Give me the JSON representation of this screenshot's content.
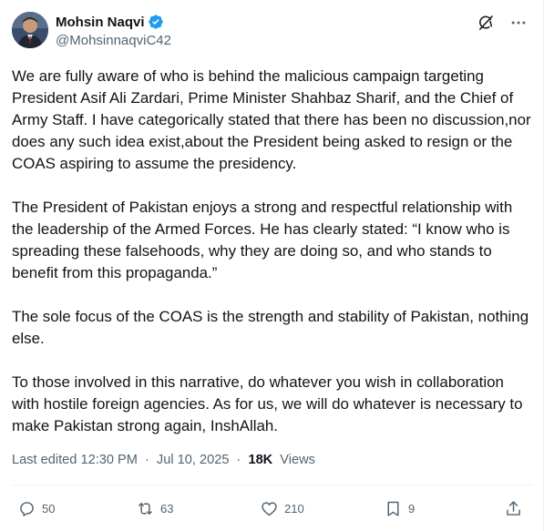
{
  "author": {
    "display_name": "Mohsin Naqvi",
    "handle": "@MohsinnaqviC42",
    "verified": true,
    "verified_color": "#1d9bf0"
  },
  "header_icons": {
    "grok": "grok-slash-icon",
    "more": "more-dots-icon"
  },
  "post": {
    "paragraphs": [
      "We are fully aware of who is behind the malicious campaign targeting President Asif Ali Zardari, Prime Minister Shahbaz Sharif, and the Chief of Army Staff. I have categorically stated that there has been no discussion,nor does any such idea exist,about the President being asked to resign or the COAS aspiring to assume the presidency.",
      "The President of Pakistan enjoys a strong and respectful relationship with the leadership of the Armed Forces. He has clearly stated: “I know who is spreading these falsehoods, why they are doing so, and who stands to benefit from this propaganda.”",
      "The sole focus of the COAS is the strength and stability of Pakistan, nothing else.",
      "To those involved in this narrative, do whatever you wish in collaboration with hostile foreign agencies. As for us, we will do whatever is necessary to make Pakistan strong again, InshAllah."
    ]
  },
  "meta": {
    "edited": "Last edited 12:30 PM",
    "separator": "·",
    "date": "Jul 10, 2025",
    "views_count": "18K",
    "views_label": "Views"
  },
  "actions": {
    "replies": "50",
    "reposts": "63",
    "likes": "210",
    "bookmarks": "9"
  },
  "colors": {
    "text": "#0f1419",
    "secondary": "#536471",
    "divider": "#eff3f4"
  }
}
